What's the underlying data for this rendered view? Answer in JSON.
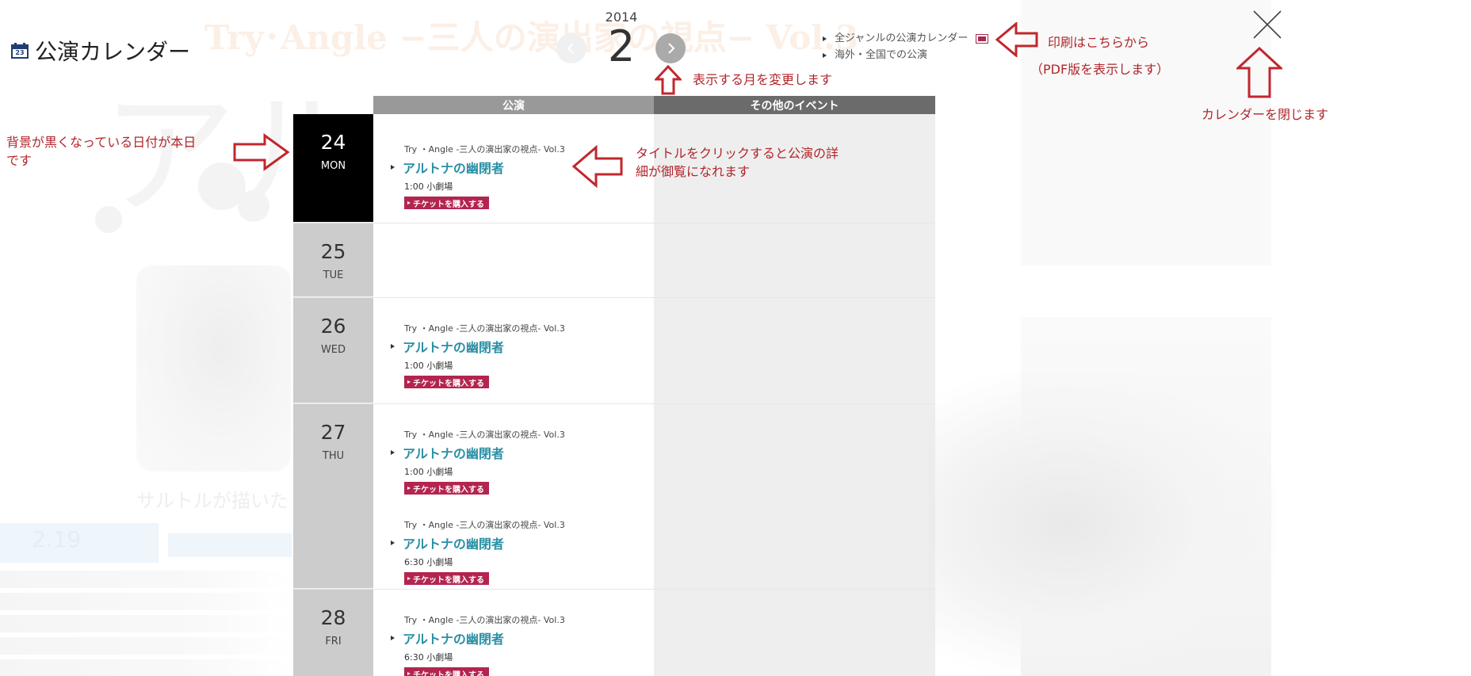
{
  "page": {
    "title": "公演カレンダー",
    "calendar_icon_day": "23"
  },
  "background": {
    "ghost_title": "Try･Angle −三人の演出家の視点− Vol.3",
    "ghost_big": "アル",
    "ghost_subtitle": "サルトルが描いた",
    "ghost_date": "2.19"
  },
  "month_nav": {
    "year": "2014",
    "month": "2",
    "prev_icon": "chevron-left-icon",
    "next_icon": "chevron-right-icon"
  },
  "top_links": {
    "all_genre_calendar": "全ジャンルの公演カレンダー",
    "overseas": "海外・全国での公演",
    "pdf_icon": "pdf-icon"
  },
  "columns": {
    "performances": "公演",
    "other_events": "その他のイベント"
  },
  "days": [
    {
      "num": "24",
      "dow": "MON",
      "today": true,
      "events": [
        {
          "series": "Try ・Angle -三人の演出家の視点- Vol.3",
          "title": "アルトナの幽閉者",
          "time": "1:00 小劇場",
          "ticket": "チケットを購入する"
        }
      ]
    },
    {
      "num": "25",
      "dow": "TUE",
      "today": false,
      "events": []
    },
    {
      "num": "26",
      "dow": "WED",
      "today": false,
      "events": [
        {
          "series": "Try ・Angle -三人の演出家の視点- Vol.3",
          "title": "アルトナの幽閉者",
          "time": "1:00 小劇場",
          "ticket": "チケットを購入する"
        }
      ]
    },
    {
      "num": "27",
      "dow": "THU",
      "today": false,
      "events": [
        {
          "series": "Try ・Angle -三人の演出家の視点- Vol.3",
          "title": "アルトナの幽閉者",
          "time": "1:00 小劇場",
          "ticket": "チケットを購入する"
        },
        {
          "series": "Try ・Angle -三人の演出家の視点- Vol.3",
          "title": "アルトナの幽閉者",
          "time": "6:30 小劇場",
          "ticket": "チケットを購入する"
        }
      ]
    },
    {
      "num": "28",
      "dow": "FRI",
      "today": false,
      "events": [
        {
          "series": "Try ・Angle -三人の演出家の視点- Vol.3",
          "title": "アルトナの幽閉者",
          "time": "6:30 小劇場",
          "ticket": "チケットを購入する"
        }
      ]
    }
  ],
  "annotations": {
    "today_note_line1": "背景が黒くなっている日付が本日",
    "today_note_line2": "です",
    "title_note_line1": "タイトルをクリックすると公演の詳",
    "title_note_line2": "細が御覧になれます",
    "month_note": "表示する月を変更します",
    "print_note_line1": "印刷はこちらから",
    "print_note_line2": "（PDF版を表示します）",
    "close_note": "カレンダーを閉じます"
  },
  "colors": {
    "accent_title": "#2a8fa5",
    "ticket": "#b3254f",
    "annotation": "#b0262b",
    "today_bg": "#000000"
  }
}
